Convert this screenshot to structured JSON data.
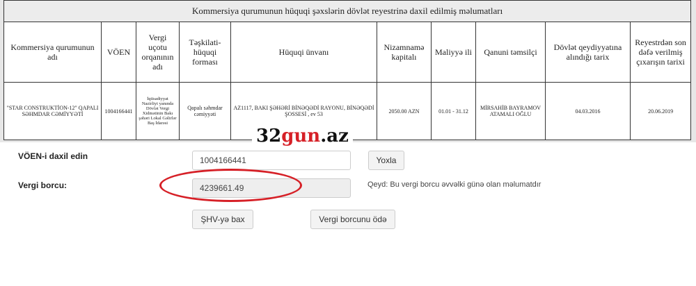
{
  "registry": {
    "title": "Kommersiya qurumunun hüquqi şəxslərin dövlət reyestrinə daxil edilmiş məlumatları",
    "headers": [
      "Kommersiya qurumunun adı",
      "VÖEN",
      "Vergi uçotu orqanının adı",
      "Təşkilati-hüquqi forması",
      "Hüquqi ünvanı",
      "Nizamnamə kapitalı",
      "Maliyyə ili",
      "Qanuni təmsilçi",
      "Dövlət qeydiyyatına alındığı tarix",
      "Reyestrdən son dəfə verilmiş çıxarışın tarixi"
    ],
    "row": [
      "\"STAR CONSTRUKTİON-12\" QAPALI SƏHMDAR CƏMİYYƏTİ",
      "1004166441",
      "İqtisadiyyat Nazirliyi yanında Dövlət Vergi Xidmətinin Bakı şəhəri Lokal Gəlirlər Baş İdarəsi",
      "Qapalı səhmdar cəmiyyəti",
      "AZ1117, BAKI ŞƏHƏRİ BİNƏQƏDİ RAYONU, BİNƏQƏDİ ŞOSSESİ , ev 53",
      "2050.00 AZN",
      "01.01 - 31.12",
      "MİRSAHİB BAYRAMOV ATAMALI OĞLU",
      "04.03.2016",
      "20.06.2019"
    ]
  },
  "watermark": {
    "part1": "32",
    "part2": "gun",
    "part3": ".az"
  },
  "form": {
    "voen_label": "VÖEN-i daxil edin",
    "voen_value": "1004166441",
    "check_button": "Yoxla",
    "debt_label": "Vergi borcu:",
    "debt_value": "4239661.49",
    "note": "Qeyd: Bu vergi borcu əvvəlki günə olan məlumatdır",
    "view_button": "ŞHV-yə bax",
    "pay_button": "Vergi borcunu ödə"
  },
  "colors": {
    "highlight": "#d62027",
    "logo_accent": "#d62027"
  }
}
